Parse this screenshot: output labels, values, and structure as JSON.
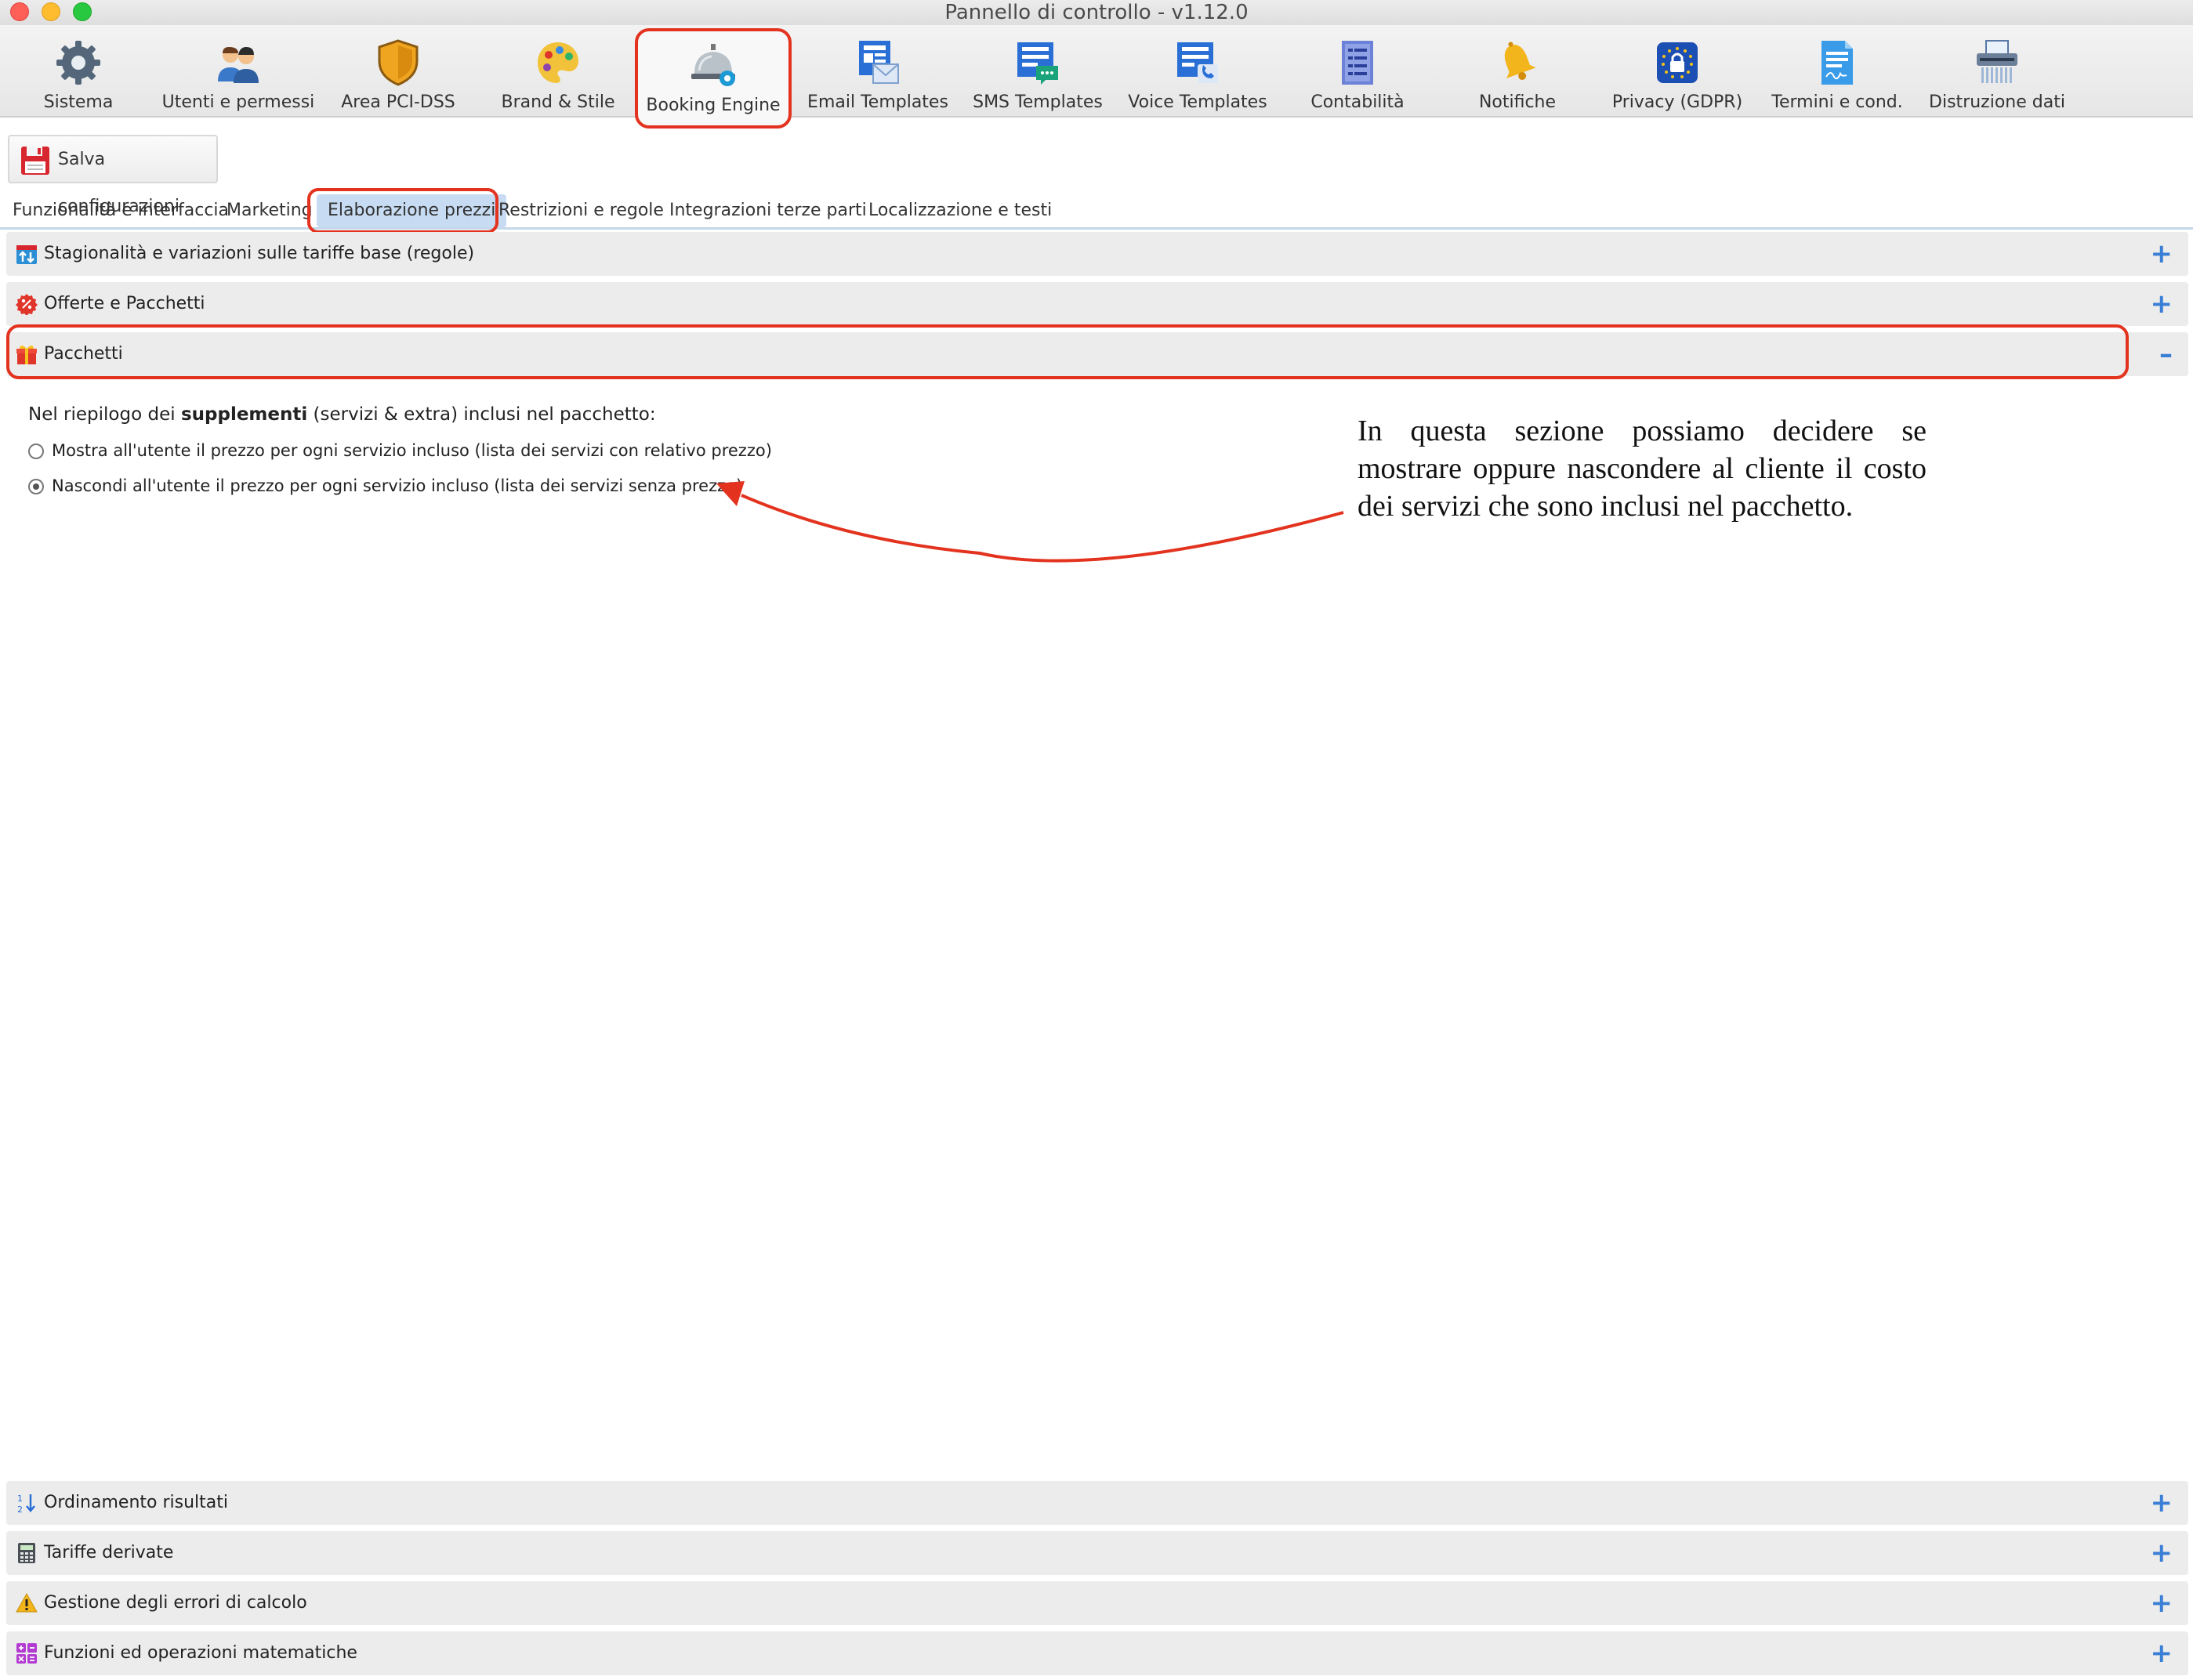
{
  "window": {
    "title": "Pannello di controllo - v1.12.0"
  },
  "toolbar": {
    "items": [
      {
        "label": "Sistema",
        "icon": "gear-icon"
      },
      {
        "label": "Utenti e permessi",
        "icon": "users-icon"
      },
      {
        "label": "Area PCI-DSS",
        "icon": "shield-icon"
      },
      {
        "label": "Brand & Stile",
        "icon": "palette-icon"
      },
      {
        "label": "Booking Engine",
        "icon": "reception-bell-icon",
        "active": true
      },
      {
        "label": "Email Templates",
        "icon": "email-template-icon"
      },
      {
        "label": "SMS Templates",
        "icon": "sms-template-icon"
      },
      {
        "label": "Voice Templates",
        "icon": "voice-template-icon"
      },
      {
        "label": "Contabilità",
        "icon": "ledger-icon"
      },
      {
        "label": "Notifiche",
        "icon": "bell-icon"
      },
      {
        "label": "Privacy (GDPR)",
        "icon": "privacy-lock-icon"
      },
      {
        "label": "Termini e cond.",
        "icon": "contract-icon"
      },
      {
        "label": "Distruzione dati",
        "icon": "shredder-icon"
      }
    ]
  },
  "save_button": {
    "label": "Salva configurazioni",
    "icon": "floppy-disk-icon"
  },
  "tabs": [
    {
      "label": "Funzionalità e interfaccia"
    },
    {
      "label": "Marketing"
    },
    {
      "label": "Elaborazione prezzi",
      "active": true
    },
    {
      "label": "Restrizioni e regole"
    },
    {
      "label": "Integrazioni terze parti"
    },
    {
      "label": "Localizzazione e testi"
    }
  ],
  "sections_top": [
    {
      "title": "Stagionalità e variazioni sulle tariffe base (regole)",
      "icon": "calendar-arrows-icon",
      "toggle": "+"
    },
    {
      "title": "Offerte e Pacchetti",
      "icon": "discount-badge-icon",
      "toggle": "+"
    },
    {
      "title": "Pacchetti",
      "icon": "gift-icon",
      "toggle": "–",
      "expanded": true
    }
  ],
  "package_section": {
    "intro_pre": "Nel riepilogo dei ",
    "intro_bold": "supplementi",
    "intro_post": " (servizi & extra) inclusi nel pacchetto:",
    "options": [
      {
        "label": "Mostra all'utente il prezzo per ogni servizio incluso (lista dei servizi con relativo prezzo)",
        "checked": false
      },
      {
        "label": "Nascondi all'utente il prezzo per ogni servizio incluso (lista dei servizi senza prezzo)",
        "checked": true
      }
    ]
  },
  "annotation": {
    "text": "In questa sezione possiamo decidere se mostrare oppure nascondere al cliente il costo dei servizi che sono inclusi nel pacchetto.",
    "color": "#e3331f"
  },
  "sections_bottom": [
    {
      "title": "Ordinamento risultati",
      "icon": "sort-numeric-icon",
      "toggle": "+"
    },
    {
      "title": "Tariffe derivate",
      "icon": "calculator-icon",
      "toggle": "+"
    },
    {
      "title": "Gestione degli errori di calcolo",
      "icon": "warning-icon",
      "toggle": "+"
    },
    {
      "title": "Funzioni ed operazioni matematiche",
      "icon": "math-operations-icon",
      "toggle": "+"
    }
  ]
}
